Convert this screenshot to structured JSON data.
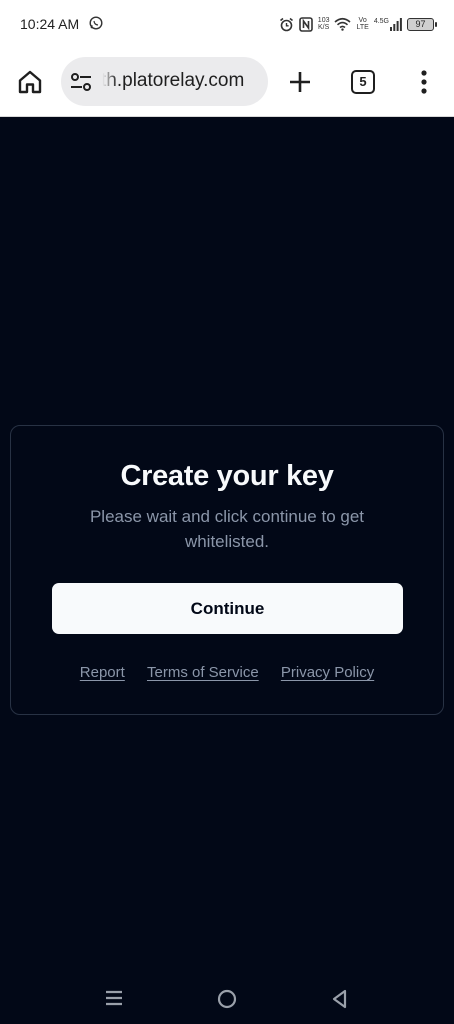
{
  "status_bar": {
    "time": "10:24 AM",
    "speed_value": "103",
    "speed_unit": "K/S",
    "volte_top": "Vo",
    "volte_bottom": "LTE",
    "network_type": "4.5G",
    "battery": "97",
    "icons": [
      "whatsapp-icon",
      "alarm-icon",
      "nfc-icon",
      "wifi-icon",
      "signal-icon",
      "battery-icon"
    ]
  },
  "browser": {
    "url": "th.platorelay.com",
    "tab_count": "5",
    "icons": [
      "home-icon",
      "site-settings-icon",
      "plus-icon",
      "tab-switcher-icon",
      "more-vert-icon"
    ]
  },
  "card": {
    "title": "Create your key",
    "description": "Please wait and click continue to get whitelisted.",
    "continue_label": "Continue",
    "links": {
      "report": "Report",
      "terms": "Terms of Service",
      "privacy": "Privacy Policy"
    }
  },
  "nav_bar": {
    "icons": [
      "recents-icon",
      "home-circle-icon",
      "back-icon"
    ]
  },
  "colors": {
    "page_background": "#020817",
    "card_border": "#283244",
    "title_text": "#f8fafc",
    "muted_text": "#8b96a9",
    "button_background": "#f8fafc"
  }
}
